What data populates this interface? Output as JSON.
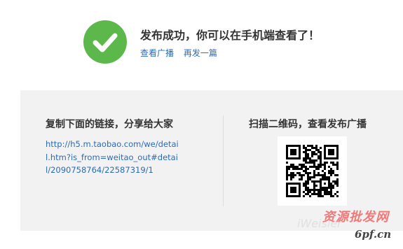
{
  "success": {
    "icon": "checkmark-icon",
    "title": "发布成功，你可以在手机端查看了！",
    "links": [
      {
        "label": "查看广播"
      },
      {
        "label": "再发一篇"
      }
    ],
    "accent_color": "#5cb84b",
    "link_color": "#2a6bb8"
  },
  "share": {
    "heading": "复制下面的链接，分享给大家",
    "link_text": "http://h5.m.taobao.com/we/detail.htm?is_from=weitao_out#detail/2090758764/22587319/1"
  },
  "qr": {
    "heading": "扫描二维码，查看发布广播",
    "icon": "qr-code-icon"
  },
  "watermark": {
    "text_top": "资源批发网",
    "text_ghost": "iWeisier",
    "text_bottom": "6pf.cn"
  }
}
